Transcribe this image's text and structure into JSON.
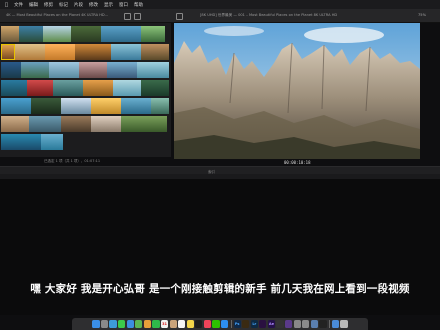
{
  "menubar": {
    "apple": "",
    "items": [
      "文件",
      "编辑",
      "修剪",
      "标记",
      "片段",
      "修改",
      "显示",
      "窗口",
      "帮助"
    ],
    "right": [
      "",
      "",
      ""
    ]
  },
  "toolbar": {
    "library_title": "4K — Most Beautiful Places on the Planet 4K ULTRA HD...",
    "viewer_title": "[8K UHD] 世界最美 — 001 – Most Beautiful Places on the Planet 8K ULTRA HD",
    "zoom": "75%"
  },
  "browser": {
    "clip_info": "已选定 1 项（共 1 项），01:07:11",
    "clip_info2": ""
  },
  "viewer": {
    "timecode": "00:00:10:18"
  },
  "timeline": {
    "tabs": [
      "索引",
      "",
      ""
    ]
  },
  "subtitle": "嘿 大家好 我是开心弘哥 是一个刚接触剪辑的新手 前几天我在网上看到一段视频",
  "dock": {
    "apps": [
      {
        "name": "finder-icon",
        "label": "",
        "color": "#3a8ee6"
      },
      {
        "name": "launchpad-icon",
        "label": "",
        "color": "#8a8a8a"
      },
      {
        "name": "safari-icon",
        "label": "",
        "color": "#3d9bd9"
      },
      {
        "name": "messages-icon",
        "label": "",
        "color": "#3cc94b"
      },
      {
        "name": "mail-icon",
        "label": "",
        "color": "#3c8de0"
      },
      {
        "name": "maps-icon",
        "label": "",
        "color": "#5bb552"
      },
      {
        "name": "photos-icon",
        "label": "",
        "color": "#e8a03a"
      },
      {
        "name": "facetime-icon",
        "label": "",
        "color": "#2fb84a"
      },
      {
        "name": "calendar-icon",
        "label": "31",
        "color": "#f2f2f2"
      },
      {
        "name": "contacts-icon",
        "label": "",
        "color": "#c9a37a"
      },
      {
        "name": "reminders-icon",
        "label": "",
        "color": "#f5f5f5"
      },
      {
        "name": "notes-icon",
        "label": "",
        "color": "#f3d54a"
      },
      {
        "name": "tv-icon",
        "label": "",
        "color": "#1c1c1c"
      },
      {
        "name": "music-icon",
        "label": "",
        "color": "#f0445a"
      },
      {
        "name": "wechat-icon",
        "label": "",
        "color": "#2dc100"
      },
      {
        "name": "app-store-icon",
        "label": "",
        "color": "#2d8ef0"
      },
      {
        "name": "photoshop-icon",
        "label": "Ps",
        "color": "#0f2a4a"
      },
      {
        "name": "illustrator-icon",
        "label": "",
        "color": "#3a2a12"
      },
      {
        "name": "lightroom-icon",
        "label": "Lr",
        "color": "#0d2a44"
      },
      {
        "name": "premiere-icon",
        "label": "",
        "color": "#2a1040"
      },
      {
        "name": "after-effects-icon",
        "label": "Ae",
        "color": "#25114a"
      },
      {
        "name": "final-cut-icon",
        "label": "",
        "color": "#333"
      },
      {
        "name": "motion-icon",
        "label": "",
        "color": "#5a3a8a"
      },
      {
        "name": "compressor-icon",
        "label": "",
        "color": "#888"
      },
      {
        "name": "settings-icon",
        "label": "",
        "color": "#8b8b8b"
      },
      {
        "name": "preview-icon",
        "label": "",
        "color": "#5a7fb0"
      },
      {
        "name": "terminal-icon",
        "label": "",
        "color": "#222"
      },
      {
        "name": "downloads-icon",
        "label": "",
        "color": "#4a8bd8"
      },
      {
        "name": "trash-icon",
        "label": "",
        "color": "#b9b9b9"
      }
    ]
  }
}
